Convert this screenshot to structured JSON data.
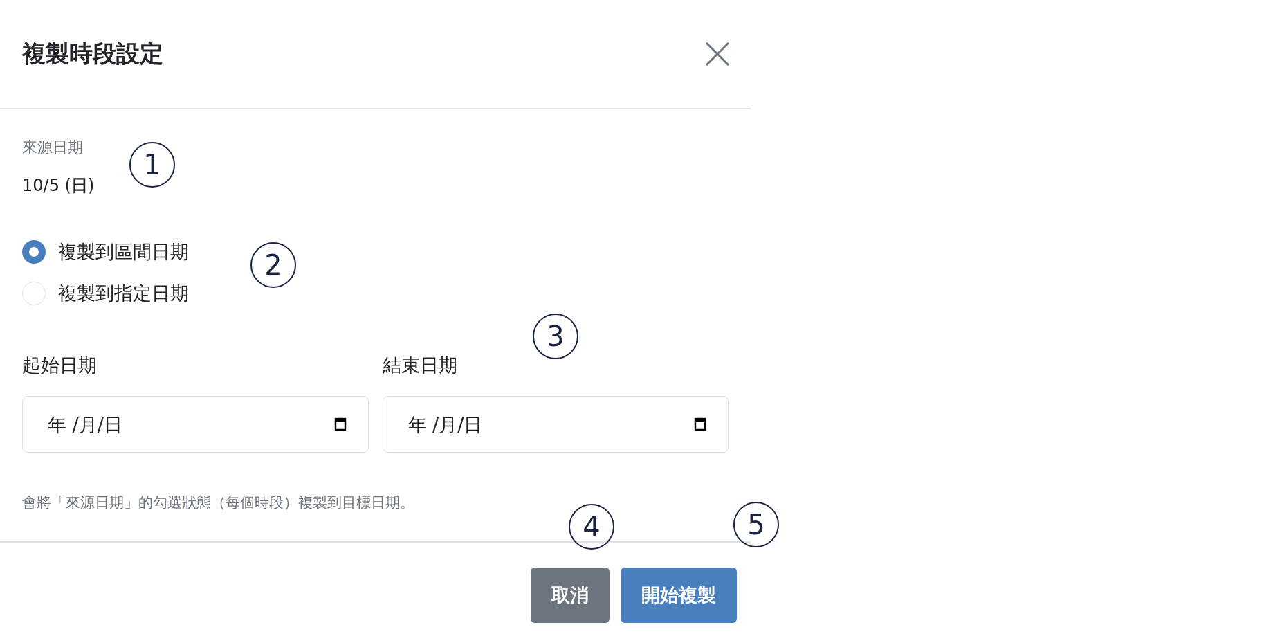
{
  "dialog": {
    "title": "複製時段設定"
  },
  "source": {
    "label": "來源日期",
    "value": "10/5 (**日**)"
  },
  "modes": [
    {
      "label": "複製到區間日期",
      "selected": true
    },
    {
      "label": "複製到指定日期",
      "selected": false
    }
  ],
  "range": [
    {
      "label": "起始日期",
      "placeholder": "年 /月/日"
    },
    {
      "label": "結束日期",
      "placeholder": "年 /月/日"
    }
  ],
  "hint": "會將「來源日期」的勾選狀態（每個時段）複製到目標日期。",
  "buttons": [
    {
      "label": "取消",
      "kind": "secondary"
    },
    {
      "label": "開始複製",
      "kind": "primary"
    }
  ],
  "callouts": [
    "1",
    "2",
    "3",
    "4",
    "5"
  ]
}
